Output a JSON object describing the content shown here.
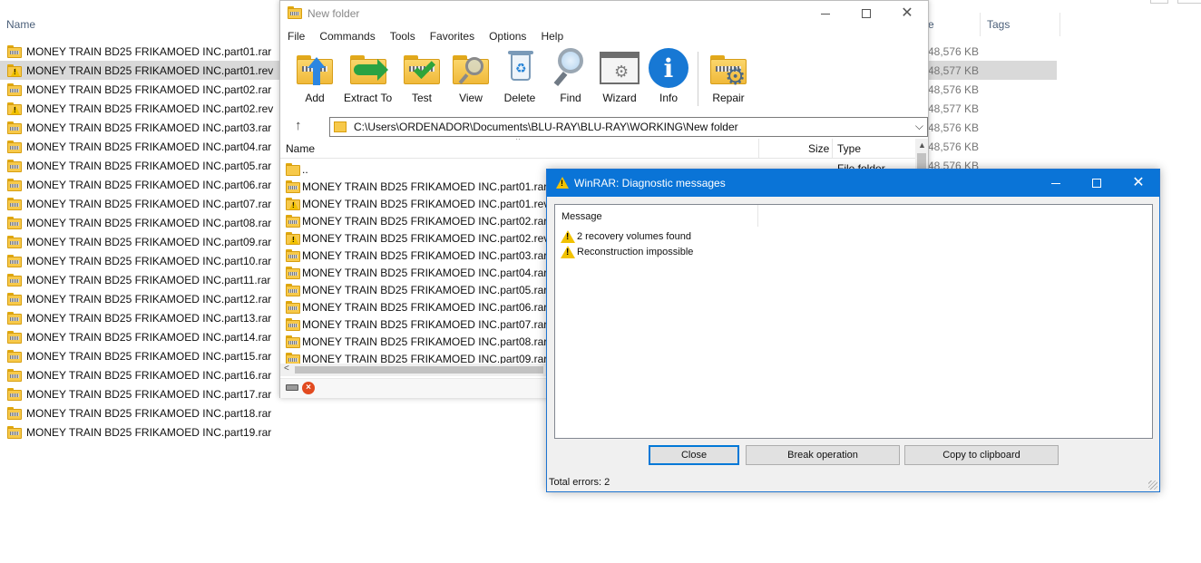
{
  "explorer": {
    "columns": {
      "name": "Name",
      "size_tail": "e",
      "tags": "Tags"
    },
    "files": [
      {
        "name": "MONEY TRAIN BD25 FRIKAMOED INC.part01.rar",
        "size": "48,576 KB",
        "warn": false,
        "selected": false
      },
      {
        "name": "MONEY TRAIN BD25 FRIKAMOED INC.part01.rev",
        "size": "48,577 KB",
        "warn": true,
        "selected": true
      },
      {
        "name": "MONEY TRAIN BD25 FRIKAMOED INC.part02.rar",
        "size": "48,576 KB",
        "warn": false,
        "selected": false
      },
      {
        "name": "MONEY TRAIN BD25 FRIKAMOED INC.part02.rev",
        "size": "48,577 KB",
        "warn": true,
        "selected": false
      },
      {
        "name": "MONEY TRAIN BD25 FRIKAMOED INC.part03.rar",
        "size": "48,576 KB",
        "warn": false,
        "selected": false
      },
      {
        "name": "MONEY TRAIN BD25 FRIKAMOED INC.part04.rar",
        "size": "48,576 KB",
        "warn": false,
        "selected": false
      },
      {
        "name": "MONEY TRAIN BD25 FRIKAMOED INC.part05.rar",
        "size": "48,576 KB",
        "warn": false,
        "selected": false
      },
      {
        "name": "MONEY TRAIN BD25 FRIKAMOED INC.part06.rar",
        "size": "",
        "warn": false,
        "selected": false
      },
      {
        "name": "MONEY TRAIN BD25 FRIKAMOED INC.part07.rar",
        "size": "",
        "warn": false,
        "selected": false
      },
      {
        "name": "MONEY TRAIN BD25 FRIKAMOED INC.part08.rar",
        "size": "",
        "warn": false,
        "selected": false
      },
      {
        "name": "MONEY TRAIN BD25 FRIKAMOED INC.part09.rar",
        "size": "",
        "warn": false,
        "selected": false
      },
      {
        "name": "MONEY TRAIN BD25 FRIKAMOED INC.part10.rar",
        "size": "",
        "warn": false,
        "selected": false
      },
      {
        "name": "MONEY TRAIN BD25 FRIKAMOED INC.part11.rar",
        "size": "",
        "warn": false,
        "selected": false
      },
      {
        "name": "MONEY TRAIN BD25 FRIKAMOED INC.part12.rar",
        "size": "",
        "warn": false,
        "selected": false
      },
      {
        "name": "MONEY TRAIN BD25 FRIKAMOED INC.part13.rar",
        "size": "",
        "warn": false,
        "selected": false
      },
      {
        "name": "MONEY TRAIN BD25 FRIKAMOED INC.part14.rar",
        "size": "",
        "warn": false,
        "selected": false
      },
      {
        "name": "MONEY TRAIN BD25 FRIKAMOED INC.part15.rar",
        "size": "",
        "warn": false,
        "selected": false
      },
      {
        "name": "MONEY TRAIN BD25 FRIKAMOED INC.part16.rar",
        "size": "",
        "warn": false,
        "selected": false
      },
      {
        "name": "MONEY TRAIN BD25 FRIKAMOED INC.part17.rar",
        "size": "",
        "warn": false,
        "selected": false
      },
      {
        "name": "MONEY TRAIN BD25 FRIKAMOED INC.part18.rar",
        "size": "",
        "warn": false,
        "selected": false
      },
      {
        "name": "MONEY TRAIN BD25 FRIKAMOED INC.part19.rar",
        "size": "",
        "warn": false,
        "selected": false
      }
    ]
  },
  "winrar": {
    "title": "New folder",
    "menu": [
      "File",
      "Commands",
      "Tools",
      "Favorites",
      "Options",
      "Help"
    ],
    "toolbar": {
      "add": "Add",
      "extract": "Extract To",
      "test": "Test",
      "view": "View",
      "delete": "Delete",
      "find": "Find",
      "wizard": "Wizard",
      "info": "Info",
      "repair": "Repair"
    },
    "path": "C:\\Users\\ORDENADOR\\Documents\\BLU-RAY\\BLU-RAY\\WORKING\\New folder",
    "columns": {
      "name": "Name",
      "size": "Size",
      "type": "Type"
    },
    "type_peek": "File folder",
    "rows": [
      {
        "name": "..",
        "warn": false,
        "folder": true
      },
      {
        "name": "MONEY TRAIN BD25 FRIKAMOED INC.part01.rar",
        "warn": false,
        "folder": false
      },
      {
        "name": "MONEY TRAIN BD25 FRIKAMOED INC.part01.rev",
        "warn": true,
        "folder": false
      },
      {
        "name": "MONEY TRAIN BD25 FRIKAMOED INC.part02.rar",
        "warn": false,
        "folder": false
      },
      {
        "name": "MONEY TRAIN BD25 FRIKAMOED INC.part02.rev",
        "warn": true,
        "folder": false
      },
      {
        "name": "MONEY TRAIN BD25 FRIKAMOED INC.part03.rar",
        "warn": false,
        "folder": false
      },
      {
        "name": "MONEY TRAIN BD25 FRIKAMOED INC.part04.rar",
        "warn": false,
        "folder": false
      },
      {
        "name": "MONEY TRAIN BD25 FRIKAMOED INC.part05.rar",
        "warn": false,
        "folder": false
      },
      {
        "name": "MONEY TRAIN BD25 FRIKAMOED INC.part06.rar",
        "warn": false,
        "folder": false
      },
      {
        "name": "MONEY TRAIN BD25 FRIKAMOED INC.part07.rar",
        "warn": false,
        "folder": false
      },
      {
        "name": "MONEY TRAIN BD25 FRIKAMOED INC.part08.rar",
        "warn": false,
        "folder": false
      },
      {
        "name": "MONEY TRAIN BD25 FRIKAMOED INC.part09.rar",
        "warn": false,
        "folder": false
      }
    ]
  },
  "diagnostic": {
    "title": "WinRAR: Diagnostic messages",
    "column": "Message",
    "messages": [
      "2 recovery volumes found",
      "Reconstruction impossible"
    ],
    "buttons": {
      "close": "Close",
      "break": "Break operation",
      "copy": "Copy to clipboard"
    },
    "total": "Total errors: 2"
  },
  "colors": {
    "accent": "#0a74d7",
    "selection": "#d9d9d9",
    "warning": "#f2c200"
  }
}
